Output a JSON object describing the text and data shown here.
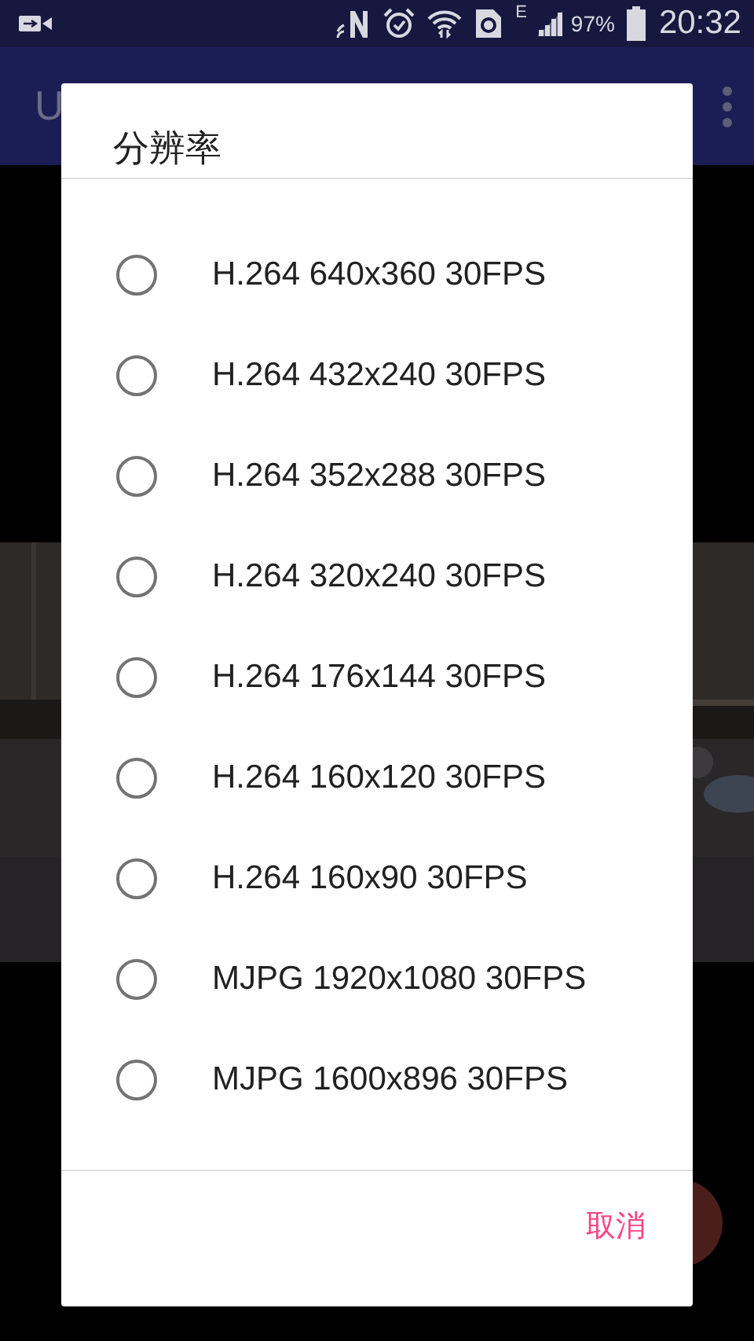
{
  "status_bar": {
    "network_type": "E",
    "battery": "97%",
    "time": "20:32"
  },
  "app_bar": {
    "title": "U"
  },
  "dialog": {
    "title": "分辨率",
    "options": [
      {
        "label": "H.264 640x360 30FPS",
        "selected": false
      },
      {
        "label": "H.264 432x240 30FPS",
        "selected": false
      },
      {
        "label": "H.264 352x288 30FPS",
        "selected": false
      },
      {
        "label": "H.264 320x240 30FPS",
        "selected": false
      },
      {
        "label": "H.264 176x144 30FPS",
        "selected": false
      },
      {
        "label": "H.264 160x120 30FPS",
        "selected": false
      },
      {
        "label": "H.264 160x90 30FPS",
        "selected": false
      },
      {
        "label": "MJPG 1920x1080 30FPS",
        "selected": false
      },
      {
        "label": "MJPG 1600x896 30FPS",
        "selected": false
      }
    ],
    "buttons": [
      {
        "label": "取消"
      }
    ]
  }
}
